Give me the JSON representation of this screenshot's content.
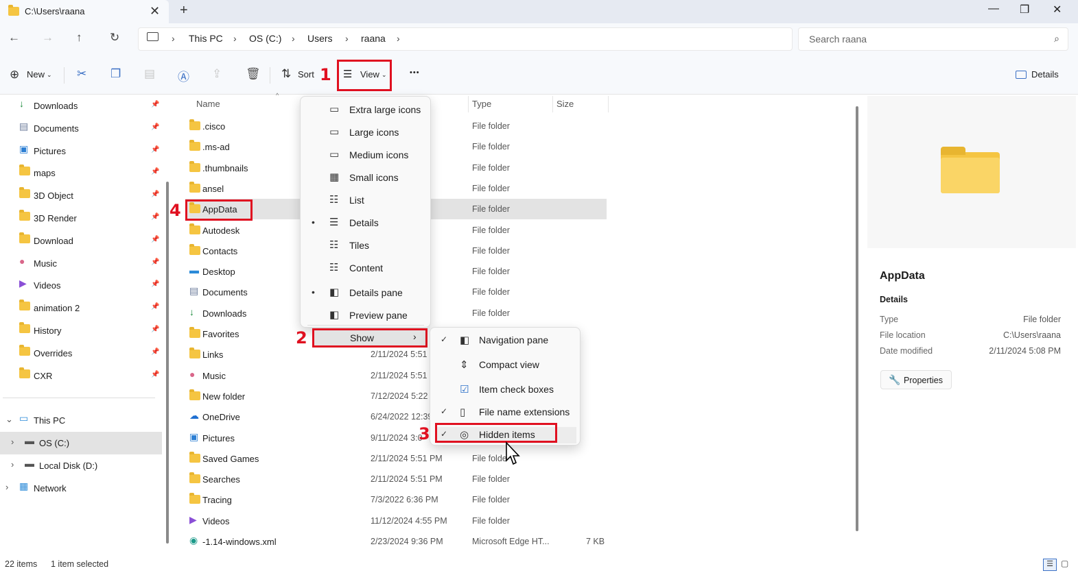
{
  "window": {
    "tab_title": "C:\\Users\\raana",
    "new_tab": "+",
    "minimize": "—",
    "maximize": "❐",
    "close": "✕",
    "tab_close": "✕"
  },
  "address": {
    "crumbs": [
      "This PC",
      "OS (C:)",
      "Users",
      "raana"
    ],
    "search_placeholder": "Search raana"
  },
  "toolbar": {
    "new_label": "New",
    "sort_label": "Sort",
    "view_label": "View",
    "more": "•••",
    "details_label": "Details"
  },
  "annotations": {
    "one": "1",
    "two": "2",
    "three": "3",
    "four": "4"
  },
  "sidebar": {
    "quick": [
      {
        "label": "Downloads",
        "icon": "download-icon"
      },
      {
        "label": "Documents",
        "icon": "documents-icon"
      },
      {
        "label": "Pictures",
        "icon": "pictures-icon"
      },
      {
        "label": "maps",
        "icon": "folder-icon"
      },
      {
        "label": "3D Object",
        "icon": "folder-icon"
      },
      {
        "label": "3D Render",
        "icon": "folder-icon"
      },
      {
        "label": "Download",
        "icon": "folder-icon"
      },
      {
        "label": "Music",
        "icon": "music-icon"
      },
      {
        "label": "Videos",
        "icon": "videos-icon"
      },
      {
        "label": "animation 2",
        "icon": "folder-icon"
      },
      {
        "label": "History",
        "icon": "folder-icon"
      },
      {
        "label": "Overrides",
        "icon": "folder-icon"
      },
      {
        "label": "CXR",
        "icon": "folder-icon"
      }
    ],
    "tree": [
      {
        "label": "This PC",
        "icon": "computer-icon"
      },
      {
        "label": "OS (C:)",
        "icon": "drive-icon"
      },
      {
        "label": "Local Disk (D:)",
        "icon": "drive-icon"
      },
      {
        "label": "Network",
        "icon": "network-icon"
      }
    ]
  },
  "columns": {
    "name": "Name",
    "type": "Type",
    "size": "Size"
  },
  "files": [
    {
      "name": ".cisco",
      "date": "PM",
      "type": "File folder",
      "size": ""
    },
    {
      "name": ".ms-ad",
      "date": "PM",
      "type": "File folder",
      "size": ""
    },
    {
      "name": ".thumbnails",
      "date": "7 AM",
      "type": "File folder",
      "size": ""
    },
    {
      "name": "ansel",
      "date": "PM",
      "type": "File folder",
      "size": ""
    },
    {
      "name": "AppData",
      "date": "PM",
      "type": "File folder",
      "size": ""
    },
    {
      "name": "Autodesk",
      "date": "PM",
      "type": "File folder",
      "size": ""
    },
    {
      "name": "Contacts",
      "date": "PM",
      "type": "File folder",
      "size": ""
    },
    {
      "name": "Desktop",
      "date": "9 PM",
      "type": "File folder",
      "size": ""
    },
    {
      "name": "Documents",
      "date": "PM",
      "type": "File folder",
      "size": ""
    },
    {
      "name": "Downloads",
      "date": "PM",
      "type": "File folder",
      "size": ""
    },
    {
      "name": "Favorites",
      "date": "",
      "type": "",
      "size": ""
    },
    {
      "name": "Links",
      "date": "2/11/2024 5:51",
      "type": "",
      "size": ""
    },
    {
      "name": "Music",
      "date": "2/11/2024 5:51",
      "type": "",
      "size": ""
    },
    {
      "name": "New folder",
      "date": "7/12/2024 5:22",
      "type": "",
      "size": ""
    },
    {
      "name": "OneDrive",
      "date": "6/24/2022 12:39",
      "type": "",
      "size": ""
    },
    {
      "name": "Pictures",
      "date": "9/11/2024 3:0",
      "type": "",
      "size": ""
    },
    {
      "name": "Saved Games",
      "date": "2/11/2024 5:51 PM",
      "type": "File folde",
      "size": ""
    },
    {
      "name": "Searches",
      "date": "2/11/2024 5:51 PM",
      "type": "File folder",
      "size": ""
    },
    {
      "name": "Tracing",
      "date": "7/3/2022 6:36 PM",
      "type": "File folder",
      "size": ""
    },
    {
      "name": "Videos",
      "date": "11/12/2024 4:55 PM",
      "type": "File folder",
      "size": ""
    },
    {
      "name": "-1.14-windows.xml",
      "date": "2/23/2024 9:36 PM",
      "type": "Microsoft Edge HT...",
      "size": "7 KB"
    }
  ],
  "view_menu": {
    "items": [
      "Extra large icons",
      "Large icons",
      "Medium icons",
      "Small icons",
      "List",
      "Details",
      "Tiles",
      "Content",
      "Details pane",
      "Preview pane"
    ],
    "show": "Show"
  },
  "show_menu": {
    "items": [
      "Navigation pane",
      "Compact view",
      "Item check boxes",
      "File name extensions",
      "Hidden items"
    ]
  },
  "details": {
    "name": "AppData",
    "heading": "Details",
    "rows": [
      {
        "k": "Type",
        "v": "File folder"
      },
      {
        "k": "File location",
        "v": "C:\\Users\\raana"
      },
      {
        "k": "Date modified",
        "v": "2/11/2024 5:08 PM"
      }
    ],
    "properties": "Properties"
  },
  "status": {
    "count": "22 items",
    "selected": "1 item selected"
  }
}
